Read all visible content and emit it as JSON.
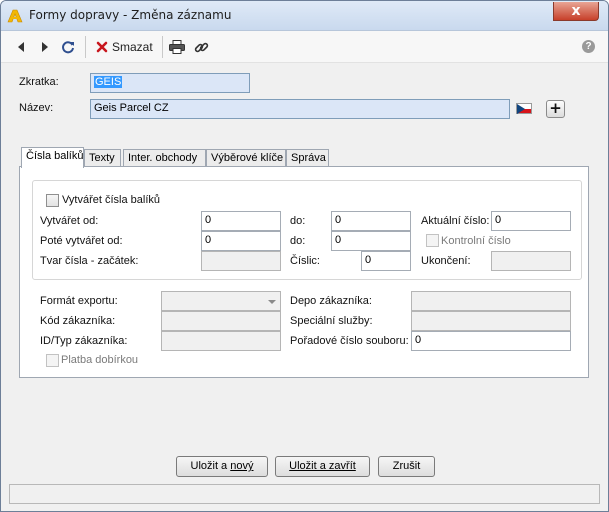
{
  "window": {
    "title": "Formy dopravy - Změna záznamu",
    "close_glyph": "x"
  },
  "toolbar": {
    "delete_label": "Smazat",
    "icons": [
      "back-icon",
      "forward-icon",
      "refresh-icon",
      "delete-icon",
      "print-icon",
      "link-icon",
      "help-icon"
    ]
  },
  "form": {
    "zkratka_label": "Zkratka:",
    "zkratka_value": "GEIS",
    "nazev_label": "Název:",
    "nazev_value": "Geis Parcel CZ"
  },
  "tabs": [
    {
      "label": "Čísla balíků",
      "active": true
    },
    {
      "label": "Texty",
      "active": false
    },
    {
      "label": "Inter. obchody",
      "active": false
    },
    {
      "label": "Výběrové klíče",
      "active": false
    },
    {
      "label": "Správa",
      "active": false
    }
  ],
  "panel": {
    "vytvaret_checkbox_label": "Vytvářet čísla balíků",
    "vytvaret_od_label": "Vytvářet od:",
    "vytvaret_od_value": "0",
    "do1_label": "do:",
    "do1_value": "0",
    "aktualni_cislo_label": "Aktuální číslo:",
    "aktualni_cislo_value": "0",
    "pote_vytvaret_od_label": "Poté vytvářet od:",
    "pote_vytvaret_od_value": "0",
    "do2_label": "do:",
    "do2_value": "0",
    "kontrolni_cislo_label": "Kontrolní číslo",
    "tvar_cisla_label": "Tvar čísla - začátek:",
    "tvar_cisla_value": "",
    "cislic_label": "Číslic:",
    "cislic_value": "0",
    "ukonceni_label": "Ukončení:",
    "ukonceni_value": "",
    "format_exportu_label": "Formát exportu:",
    "format_exportu_value": "",
    "depo_label": "Depo zákazníka:",
    "depo_value": "",
    "kod_zakaznika_label": "Kód zákazníka:",
    "kod_zakaznika_value": "",
    "specialni_sluzby_label": "Speciální služby:",
    "specialni_sluzby_value": "",
    "id_typ_label": "ID/Typ zákazníka:",
    "id_typ_value": "",
    "poradove_cislo_label": "Pořadové číslo souboru:",
    "poradove_cislo_value": "0",
    "platba_dobirkou_label": "Platba dobírkou"
  },
  "buttons": {
    "save_new_pre": "Uložit a ",
    "save_new_ul": "nový",
    "save_close_pre": "",
    "save_close_ul": "Uložit a zavřít",
    "cancel": "Zrušit"
  }
}
